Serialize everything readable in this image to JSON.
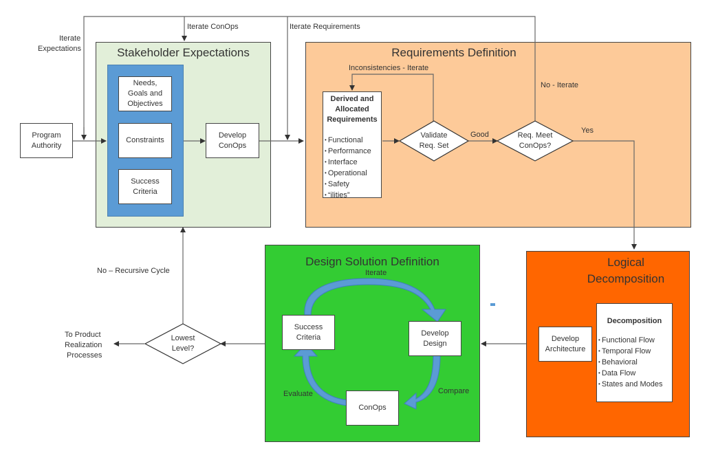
{
  "colors": {
    "stakeholder_bg": "#e2efd9",
    "inner_blue": "#5b9bd5",
    "requirements_bg": "#fdca99",
    "design_bg": "#33cc33",
    "logical_bg": "#ff6600",
    "line": "#555555",
    "cycle_arrow": "#5b9bd5"
  },
  "labels": {
    "iterate_expectations": [
      "Iterate",
      "Expectations"
    ],
    "iterate_conops": "Iterate ConOps",
    "iterate_requirements": "Iterate Requirements",
    "no_iterate": "No - Iterate",
    "inconsistencies_iterate": "Inconsistencies - Iterate",
    "good": "Good",
    "yes": "Yes",
    "no_recursive_cycle": "No – Recursive Cycle",
    "to_product_realization": [
      "To Product",
      "Realization",
      "Processes"
    ]
  },
  "program_authority": [
    "Program",
    "Authority"
  ],
  "stakeholder": {
    "title": "Stakeholder Expectations",
    "items": [
      [
        "Needs,",
        "Goals and",
        "Objectives"
      ],
      [
        "Constraints"
      ],
      [
        "Success",
        "Criteria"
      ]
    ],
    "develop_conops": [
      "Develop",
      "ConOps"
    ]
  },
  "requirements": {
    "title": "Requirements Definition",
    "derived_title": [
      "Derived and",
      "Allocated",
      "Requirements"
    ],
    "derived_items": [
      "Functional",
      "Performance",
      "Interface",
      "Operational",
      "Safety",
      "“ilities”"
    ],
    "validate": [
      "Validate",
      "Req. Set"
    ],
    "meet_conops": [
      "Req. Meet",
      "ConOps?"
    ]
  },
  "logical": {
    "title": [
      "Logical",
      "Decomposition"
    ],
    "develop_architecture": [
      "Develop",
      "Architecture"
    ],
    "decomposition_title": "Decomposition",
    "decomposition_items": [
      "Functional Flow",
      "Temporal Flow",
      "Behavioral",
      "Data Flow",
      "States and Modes"
    ]
  },
  "design": {
    "title": "Design Solution Definition",
    "iterate": "Iterate",
    "compare": "Compare",
    "evaluate": "Evaluate",
    "success_criteria": [
      "Success",
      "Criteria"
    ],
    "develop_design": [
      "Develop",
      "Design"
    ],
    "conops": "ConOps"
  },
  "lowest_level": [
    "Lowest",
    "Level?"
  ]
}
